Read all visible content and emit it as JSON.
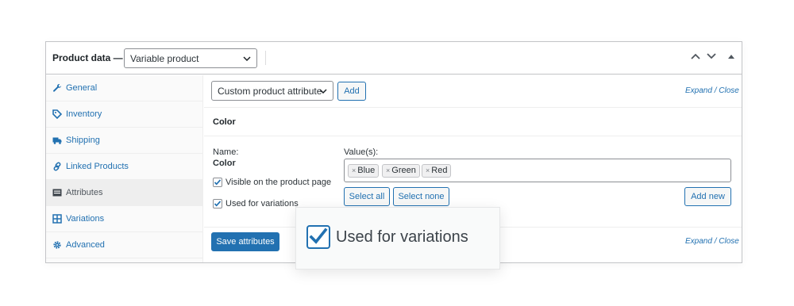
{
  "header": {
    "title": "Product data —",
    "product_type": "Variable product"
  },
  "sidebar": {
    "items": [
      {
        "label": "General",
        "icon": "wrench-icon"
      },
      {
        "label": "Inventory",
        "icon": "tag-icon"
      },
      {
        "label": "Shipping",
        "icon": "truck-icon"
      },
      {
        "label": "Linked Products",
        "icon": "link-icon"
      },
      {
        "label": "Attributes",
        "icon": "list-icon"
      },
      {
        "label": "Variations",
        "icon": "grid-icon"
      },
      {
        "label": "Advanced",
        "icon": "gear-icon"
      }
    ],
    "active": "Attributes"
  },
  "toolbar": {
    "attribute_select": "Custom product attribute",
    "add_label": "Add",
    "expand_close": "Expand / Close"
  },
  "attribute": {
    "title": "Color",
    "name_label": "Name:",
    "name_value": "Color",
    "visible_label": "Visible on the product page",
    "variations_label": "Used for variations",
    "values_label": "Value(s):",
    "values": [
      "Blue",
      "Green",
      "Red"
    ],
    "select_all": "Select all",
    "select_none": "Select none",
    "add_new": "Add new"
  },
  "footer": {
    "save_label": "Save attributes",
    "expand_close": "Expand / Close"
  },
  "callout": {
    "label": "Used for variations"
  },
  "colors": {
    "accent": "#2271b1",
    "border": "#c3c4c7"
  }
}
